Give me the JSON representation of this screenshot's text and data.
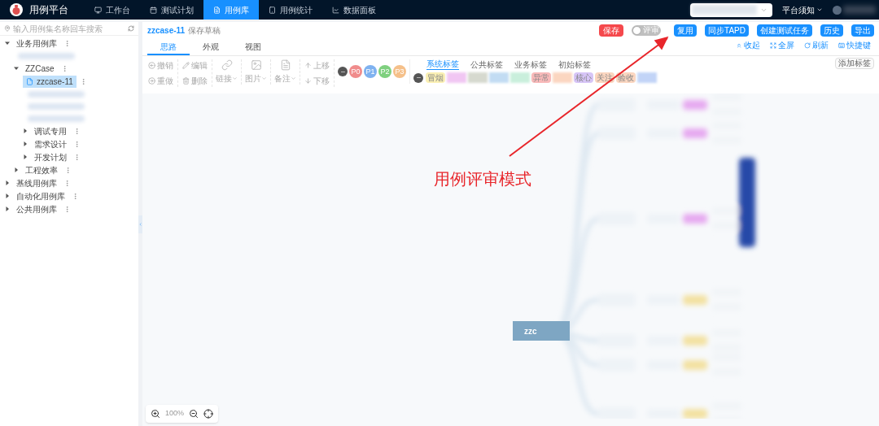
{
  "app": {
    "title": "用例平台"
  },
  "nav": [
    {
      "label": "工作台",
      "selected": false
    },
    {
      "label": "测试计划",
      "selected": false
    },
    {
      "label": "用例库",
      "selected": true
    },
    {
      "label": "用例统计",
      "selected": false
    },
    {
      "label": "数据面板",
      "selected": false
    }
  ],
  "header_right": {
    "notice": "平台须知"
  },
  "sidebar": {
    "search": {
      "placeholder": "输入用例集名称回车搜索"
    },
    "tree": [
      {
        "label": "业务用例库",
        "expanded": true,
        "children": [
          {
            "kind": "redacted"
          },
          {
            "label": "ZZCase",
            "expanded": true,
            "children": [
              {
                "label": "zzcase-11",
                "kind": "file",
                "selected": true
              },
              {
                "kind": "redacted"
              },
              {
                "kind": "redacted"
              },
              {
                "kind": "redacted"
              },
              {
                "label": "调试专用",
                "expanded": false
              },
              {
                "label": "需求设计",
                "expanded": false
              },
              {
                "label": "开发计划",
                "expanded": false
              }
            ]
          },
          {
            "label": "工程效率",
            "expanded": false
          }
        ]
      },
      {
        "label": "基线用例库",
        "expanded": false
      },
      {
        "label": "自动化用例库",
        "expanded": false
      },
      {
        "label": "公共用例库",
        "expanded": false
      }
    ]
  },
  "case": {
    "name": "zzcase-11",
    "status": "保存草稿"
  },
  "actions": [
    {
      "label": "保存",
      "kind": "danger"
    },
    {
      "label": "评审",
      "kind": "switch",
      "on": false
    },
    {
      "label": "复用",
      "kind": "primary"
    },
    {
      "label": "同步TAPD",
      "kind": "primary"
    },
    {
      "label": "创建测试任务",
      "kind": "primary"
    },
    {
      "label": "历史",
      "kind": "primary"
    },
    {
      "label": "导出",
      "kind": "primary"
    }
  ],
  "tabs": [
    {
      "label": "思路",
      "selected": true
    },
    {
      "label": "外观",
      "selected": false
    },
    {
      "label": "视图",
      "selected": false
    }
  ],
  "view_links": [
    "收起",
    "全屏",
    "刷新",
    "快捷键"
  ],
  "toolbar": {
    "history": [
      "撤销",
      "重做"
    ],
    "edit": [
      "编辑",
      "删除"
    ],
    "inserts": [
      "链接",
      "图片",
      "备注"
    ],
    "move": [
      "上移",
      "下移"
    ],
    "priorities": [
      {
        "label": "P0",
        "color": "#f08c8c"
      },
      {
        "label": "P1",
        "color": "#7fb2f0"
      },
      {
        "label": "P2",
        "color": "#7fd07f"
      },
      {
        "label": "P3",
        "color": "#f5c08a"
      }
    ]
  },
  "tag_tabs": [
    {
      "label": "系统标签",
      "selected": true
    },
    {
      "label": "公共标签",
      "selected": false
    },
    {
      "label": "业务标签",
      "selected": false
    },
    {
      "label": "初始标签",
      "selected": false
    }
  ],
  "tags": [
    {
      "label": "冒烟",
      "color": "#fbf0b4"
    },
    {
      "kind": "redacted",
      "color": "#f1c6f3"
    },
    {
      "kind": "redacted",
      "color": "#d6d9cf"
    },
    {
      "kind": "redacted",
      "color": "#c2dcf3"
    },
    {
      "kind": "redacted",
      "color": "#c9efdc"
    },
    {
      "label": "异常",
      "color": "#f8b9b9"
    },
    {
      "kind": "redacted",
      "color": "#fbd6c0"
    },
    {
      "label": "核心",
      "color": "#d7c5f7"
    },
    {
      "label": "关注",
      "color": "#fbd6c0"
    },
    {
      "label": "验收",
      "color": "#fbd6c0"
    },
    {
      "kind": "redacted",
      "color": "#c2d4f7"
    }
  ],
  "add_tag": "添加标签",
  "mindmap": {
    "root": "zzc"
  },
  "zoom": {
    "value": "100%"
  },
  "annotation": {
    "text": "用例评审模式"
  }
}
